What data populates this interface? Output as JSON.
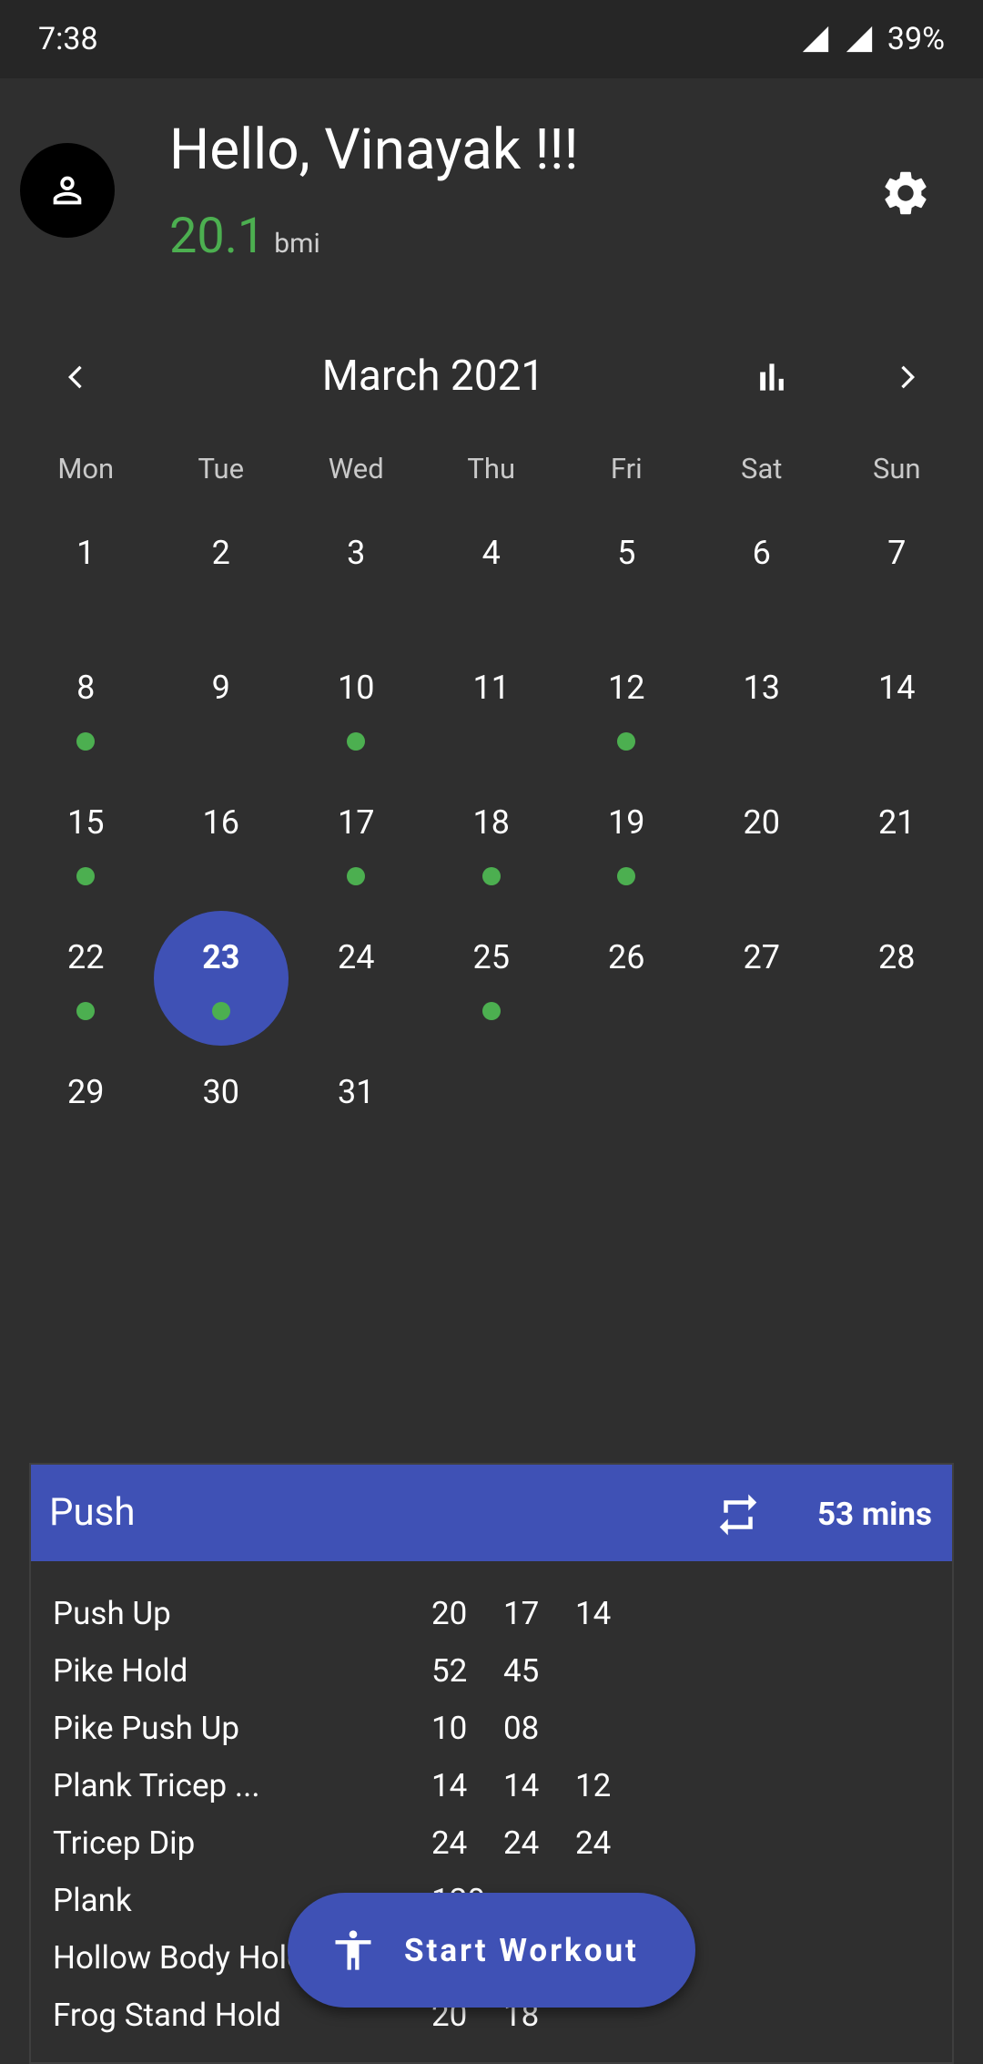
{
  "status_bar": {
    "time": "7:38",
    "battery": "39%"
  },
  "header": {
    "greeting": "Hello, Vinayak !!!",
    "bmi_value": "20.1",
    "bmi_unit": "bmi"
  },
  "calendar": {
    "month_title": "March 2021",
    "weekdays": [
      "Mon",
      "Tue",
      "Wed",
      "Thu",
      "Fri",
      "Sat",
      "Sun"
    ],
    "selected_day": 23,
    "days": [
      {
        "d": "1",
        "dot": false
      },
      {
        "d": "2",
        "dot": false
      },
      {
        "d": "3",
        "dot": false
      },
      {
        "d": "4",
        "dot": false
      },
      {
        "d": "5",
        "dot": false
      },
      {
        "d": "6",
        "dot": false
      },
      {
        "d": "7",
        "dot": false
      },
      {
        "d": "8",
        "dot": true
      },
      {
        "d": "9",
        "dot": false
      },
      {
        "d": "10",
        "dot": true
      },
      {
        "d": "11",
        "dot": false
      },
      {
        "d": "12",
        "dot": true
      },
      {
        "d": "13",
        "dot": false
      },
      {
        "d": "14",
        "dot": false
      },
      {
        "d": "15",
        "dot": true
      },
      {
        "d": "16",
        "dot": false
      },
      {
        "d": "17",
        "dot": true
      },
      {
        "d": "18",
        "dot": true
      },
      {
        "d": "19",
        "dot": true
      },
      {
        "d": "20",
        "dot": false
      },
      {
        "d": "21",
        "dot": false
      },
      {
        "d": "22",
        "dot": true
      },
      {
        "d": "23",
        "dot": true
      },
      {
        "d": "24",
        "dot": false
      },
      {
        "d": "25",
        "dot": true
      },
      {
        "d": "26",
        "dot": false
      },
      {
        "d": "27",
        "dot": false
      },
      {
        "d": "28",
        "dot": false
      },
      {
        "d": "29",
        "dot": false
      },
      {
        "d": "30",
        "dot": false
      },
      {
        "d": "31",
        "dot": false
      }
    ]
  },
  "workout": {
    "title": "Push",
    "duration": "53 mins",
    "exercises": [
      {
        "name": "Push Up",
        "reps": [
          "20",
          "17",
          "14"
        ]
      },
      {
        "name": "Pike Hold",
        "reps": [
          "52",
          "45"
        ]
      },
      {
        "name": "Pike Push Up",
        "reps": [
          "10",
          "08"
        ]
      },
      {
        "name": "Plank Tricep ...",
        "reps": [
          "14",
          "14",
          "12"
        ]
      },
      {
        "name": "Tricep Dip",
        "reps": [
          "24",
          "24",
          "24"
        ]
      },
      {
        "name": "Plank",
        "reps": [
          "120"
        ]
      },
      {
        "name": "Hollow Body Hold",
        "reps": [
          "",
          ""
        ]
      },
      {
        "name": "Frog Stand Hold",
        "reps": [
          "20",
          "18"
        ]
      }
    ]
  },
  "fab": {
    "label": "Start Workout"
  },
  "colors": {
    "accent": "#3f51b5",
    "dot_green": "#4caf50",
    "background": "#2f2f2f"
  }
}
